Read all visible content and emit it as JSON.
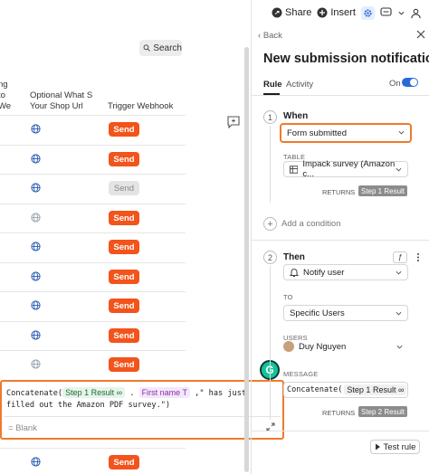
{
  "search": {
    "label": "Search"
  },
  "table": {
    "headers": {
      "col_a": "ng to We",
      "col_b": "Optional What S Your Shop Url",
      "col_c": "Trigger Webhook"
    },
    "rows": [
      {
        "send": "Send",
        "disabled": false
      },
      {
        "send": "Send",
        "disabled": false
      },
      {
        "send": "Send",
        "disabled": true
      },
      {
        "send": "Send",
        "disabled": false
      },
      {
        "send": "Send",
        "disabled": false
      },
      {
        "send": "Send",
        "disabled": false
      },
      {
        "send": "Send",
        "disabled": false
      },
      {
        "send": "Send",
        "disabled": false
      }
    ],
    "last_send": "Send"
  },
  "formula": {
    "func": "Concatenate(",
    "pill1": "Step 1 Result",
    "dot": ".",
    "pill2": "First name",
    "rest": ",\" has just filled out the Amazon PDF survey.\")",
    "blank": "= Blank"
  },
  "toolbar": {
    "share": "Share",
    "insert": "Insert"
  },
  "panel": {
    "back": "Back",
    "title": "New submission notification",
    "tab_rule": "Rule",
    "tab_activity": "Activity",
    "on_label": "On",
    "when": {
      "num": "1",
      "label": "When",
      "trigger": "Form submitted",
      "table_label": "TABLE",
      "table_value": "Impack survey (Amazon c...",
      "returns": "RETURNS",
      "returns_value": "Step 1 Result"
    },
    "add_condition": "Add a condition",
    "then": {
      "num": "2",
      "label": "Then",
      "action": "Notify user",
      "to_label": "TO",
      "to_value": "Specific Users",
      "users_label": "USERS",
      "user": "Duy Nguyen",
      "message_label": "MESSAGE",
      "message_func": "Concatenate(",
      "message_pill": "Step 1 Result",
      "returns": "RETURNS",
      "returns_value": "Step 2 Result"
    },
    "test_rule": "Test rule"
  },
  "colors": {
    "accent_orange": "#f2541b",
    "highlight_border": "#ef7a2c",
    "toggle_blue": "#2a6ad8"
  }
}
